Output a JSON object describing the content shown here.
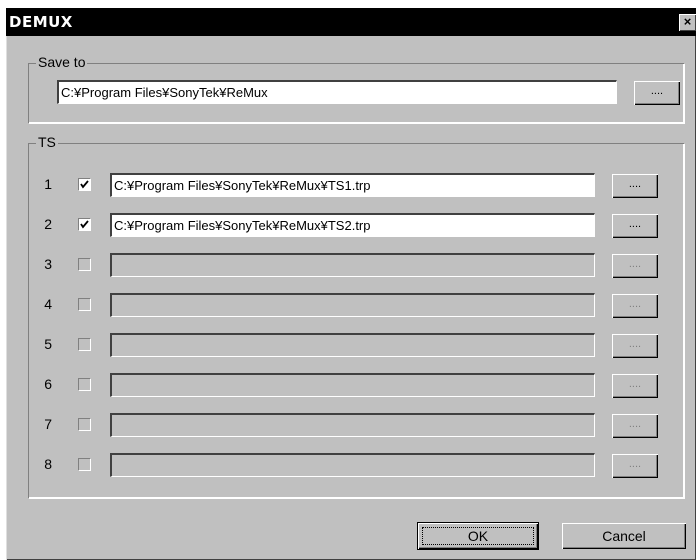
{
  "window": {
    "title": "DEMUX",
    "close_label": "×"
  },
  "save_to": {
    "legend": "Save to",
    "path": "C:¥Program Files¥SonyTek¥ReMux",
    "browse_label": "...."
  },
  "ts": {
    "legend": "TS",
    "browse_label": "....",
    "rows": [
      {
        "num": "1",
        "checked": true,
        "path": "C:¥Program Files¥SonyTek¥ReMux¥TS1.trp"
      },
      {
        "num": "2",
        "checked": true,
        "path": "C:¥Program Files¥SonyTek¥ReMux¥TS2.trp"
      },
      {
        "num": "3",
        "checked": false,
        "path": ""
      },
      {
        "num": "4",
        "checked": false,
        "path": ""
      },
      {
        "num": "5",
        "checked": false,
        "path": ""
      },
      {
        "num": "6",
        "checked": false,
        "path": ""
      },
      {
        "num": "7",
        "checked": false,
        "path": ""
      },
      {
        "num": "8",
        "checked": false,
        "path": ""
      }
    ]
  },
  "buttons": {
    "ok": "OK",
    "cancel": "Cancel"
  }
}
